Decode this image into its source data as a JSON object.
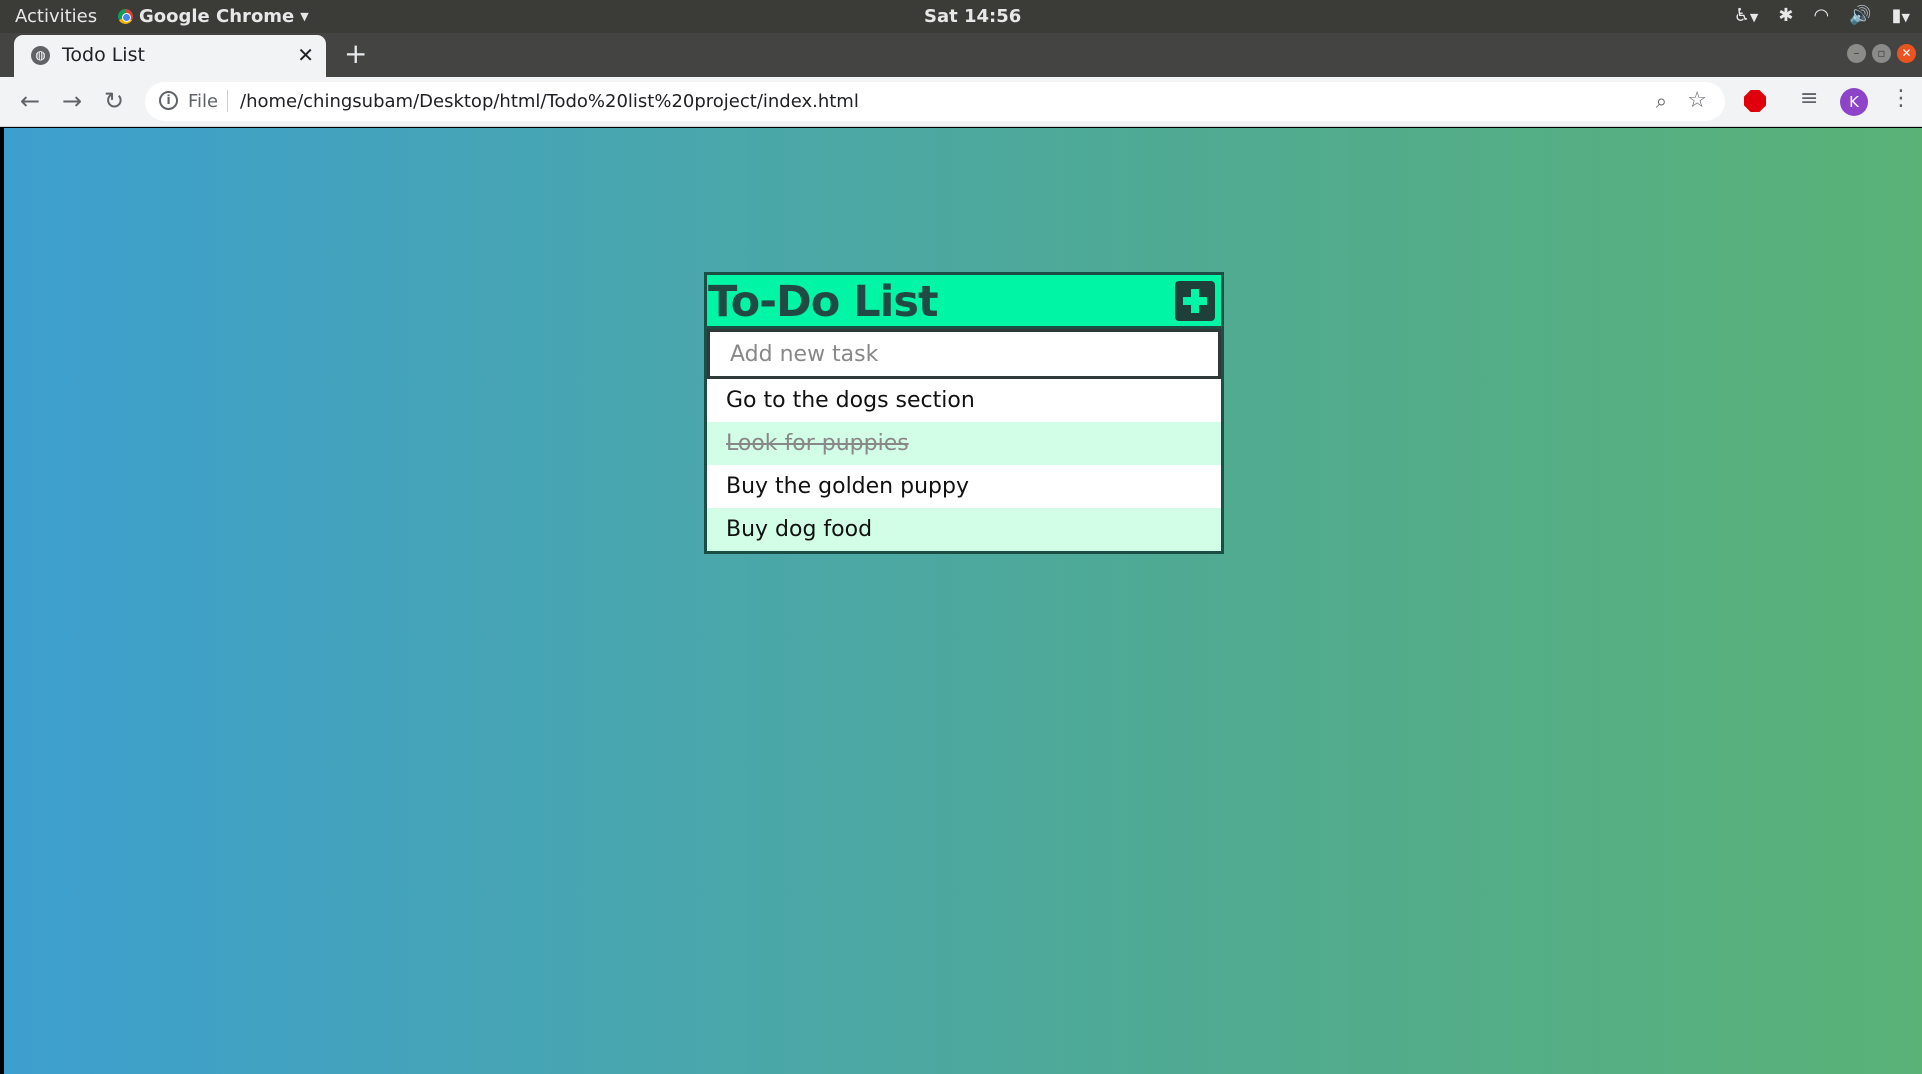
{
  "system_bar": {
    "activities": "Activities",
    "app_name": "Google Chrome",
    "clock": "Sat 14:56"
  },
  "browser": {
    "tab_title": "Todo List",
    "url_scheme": "File",
    "url": "/home/chingsubam/Desktop/html/Todo%20list%20project/index.html",
    "profile_initial": "K"
  },
  "todo": {
    "title": "To-Do List",
    "input_placeholder": "Add new task",
    "tasks": [
      {
        "text": "Go to the dogs section",
        "done": false
      },
      {
        "text": "Look for puppies",
        "done": true
      },
      {
        "text": "Buy the golden puppy",
        "done": false
      },
      {
        "text": "Buy dog food",
        "done": false
      }
    ]
  },
  "colors": {
    "header_bg": "#00f5a4",
    "border": "#1d4e46",
    "alt_row": "#d2fde6",
    "gradient_start": "#3d9fcf",
    "gradient_end": "#5ab277"
  }
}
